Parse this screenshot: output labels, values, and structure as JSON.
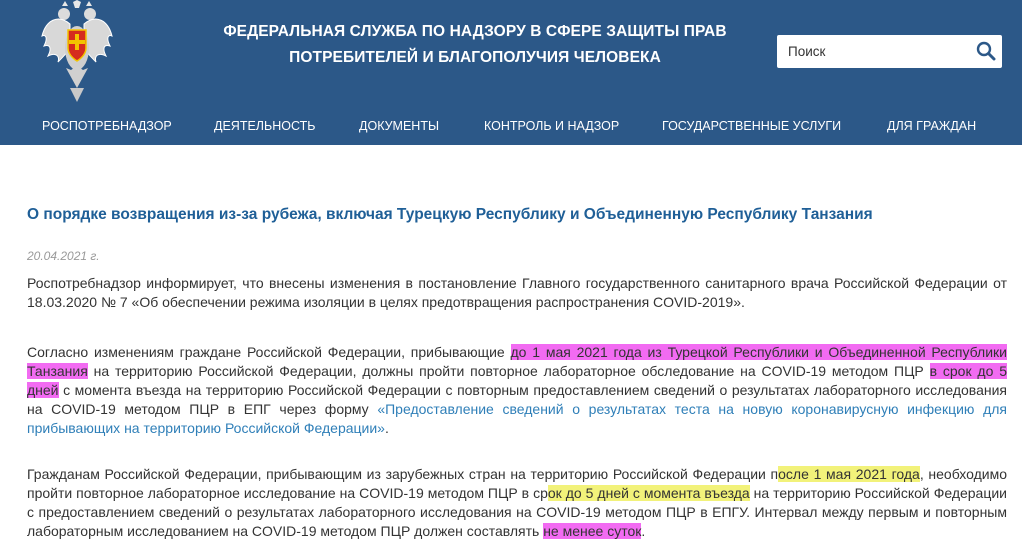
{
  "header": {
    "title_line1": "ФЕДЕРАЛЬНАЯ СЛУЖБА ПО НАДЗОРУ В СФЕРЕ ЗАЩИТЫ ПРАВ",
    "title_line2": "ПОТРЕБИТЕЛЕЙ И БЛАГОПОЛУЧИЯ ЧЕЛОВЕКА",
    "background_color": "#2c5888",
    "emblem_icon": "double-headed-eagle-emblem-icon"
  },
  "search": {
    "placeholder": "Поиск",
    "icon": "search-icon"
  },
  "nav": {
    "items": [
      {
        "label": "РОСПОТРЕБНАДЗОР"
      },
      {
        "label": "ДЕЯТЕЛЬНОСТЬ"
      },
      {
        "label": "ДОКУМЕНТЫ"
      },
      {
        "label": "КОНТРОЛЬ И НАДЗОР"
      },
      {
        "label": "ГОСУДАРСТВЕННЫЕ УСЛУГИ"
      },
      {
        "label": "ДЛЯ ГРАЖДАН"
      }
    ]
  },
  "article": {
    "headline": "О порядке возвращения из-за рубежа, включая Турецкую Республику и Объединенную Республику Танзания",
    "date": "20.04.2021 г.",
    "p1": "Роспотребнадзор информирует, что внесены изменения в постановление Главного государственного санитарного врача Российской Федерации от 18.03.2020 № 7 «Об обеспечении режима изоляции в целях предотвращения распространения COVID-2019».",
    "p2": {
      "t1": "Согласно изменениям граждане Российской Федерации, прибывающие ",
      "h1": "до 1 мая 2021 года из Турецкой Республики и Объединенной Республики Танзания",
      "t2": " на территорию Российской Федерации, должны пройти повторное лабораторное обследование на COVID-19 методом ПЦР ",
      "h2": "в срок до 5 дней",
      "t3": " с момента въезда на территорию Российской Федерации с повторным предоставлением сведений о результатах лабораторного исследования на COVID-19 методом ПЦР в ЕПГ через форму ",
      "link": "«Предоставление сведений о результатах теста на новую коронавирусную инфекцию для прибывающих на территорию Российской Федерации»",
      "t4": "."
    },
    "p3": {
      "t1": "Гражданам Российской Федерации, прибывающим из зарубежных стран на территорию Российской Федерации п",
      "h1": "осле 1 мая 2021 года",
      "t2": ", необходимо пройти повторное лабораторное исследование на COVID-19 методом ПЦР в ср",
      "h2": "ок до 5 дней с момента въезда",
      "t3": " на территорию Российской Федерации с предоставлением сведений о результатах лабораторного исследования на COVID-19 методом ПЦР в ЕПГУ. Интервал между первым и повторным лабораторным исследованием на COVID-19 методом ПЦР должен составлять ",
      "h3": "не менее суток",
      "t4": "."
    },
    "highlight_colors": {
      "pink": "#f26bf2",
      "yellow": "#f2f27a"
    },
    "headline_color": "#1f5f97",
    "link_color": "#2f7fb8"
  }
}
